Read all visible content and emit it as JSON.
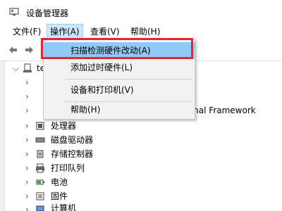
{
  "window": {
    "title": "设备管理器"
  },
  "menubar": [
    {
      "label": "文件(F)"
    },
    {
      "label": "操作(A)"
    },
    {
      "label": "查看(V)"
    },
    {
      "label": "帮助(H)"
    }
  ],
  "dropdown": {
    "items": [
      {
        "label": "扫描检测硬件改动(A)",
        "highlighted": true
      },
      {
        "label": "添加过时硬件(L)"
      },
      {
        "label": "设备和打印机(V)"
      },
      {
        "label": "帮助(H)"
      }
    ]
  },
  "tree": {
    "root_partial": "te",
    "partial_item": "ermal Framework",
    "items": [
      {
        "label": "处理器",
        "icon": "processor-icon"
      },
      {
        "label": "磁盘驱动器",
        "icon": "disk-drive-icon"
      },
      {
        "label": "存储控制器",
        "icon": "storage-controller-icon"
      },
      {
        "label": "打印队列",
        "icon": "print-queue-icon"
      },
      {
        "label": "电池",
        "icon": "battery-icon"
      },
      {
        "label": "固件",
        "icon": "firmware-icon"
      },
      {
        "label": "计算机",
        "icon": "computer-icon"
      }
    ]
  },
  "colors": {
    "highlight": "#91c9f7",
    "menu_active": "#cce8ff",
    "annotation_red": "#e8262b"
  }
}
